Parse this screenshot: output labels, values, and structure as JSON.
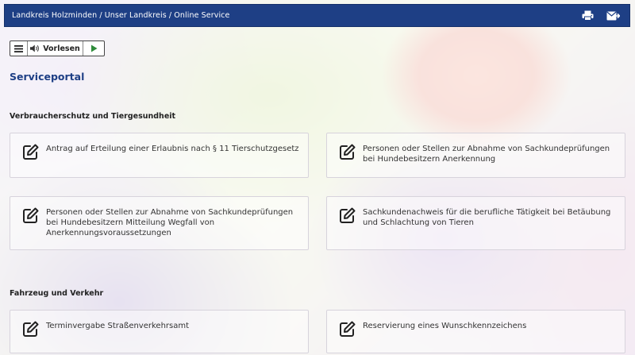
{
  "breadcrumb": "Landkreis Holzminden / Unser Landkreis / Online Service",
  "toolbar": {
    "print_icon": "printer-icon",
    "mail_icon": "envelope-send-icon"
  },
  "reader": {
    "label": "Vorlesen"
  },
  "portal_title": "Serviceportal",
  "sections": [
    {
      "title": "Verbraucherschutz und Tiergesundheit",
      "items": [
        "Antrag auf Erteilung einer Erlaubnis nach § 11 Tierschutzgesetz",
        "Personen oder Stellen zur Abnahme von Sachkundeprüfungen bei Hundebesitzern Anerkennung",
        "Personen oder Stellen zur Abnahme von Sachkundeprüfungen bei Hundebesitzern Mitteilung Wegfall von Anerkennungsvoraussetzungen",
        "Sachkundenachweis für die berufliche Tätigkeit bei Betäubung und Schlachtung von Tieren"
      ]
    },
    {
      "title": "Fahrzeug und Verkehr",
      "items": [
        "Terminvergabe Straßenverkehrsamt",
        "Reservierung eines Wunschkennzeichens"
      ]
    }
  ],
  "colors": {
    "header": "#1e3f85",
    "title": "#1e3f85",
    "play": "#2e8b3a"
  }
}
